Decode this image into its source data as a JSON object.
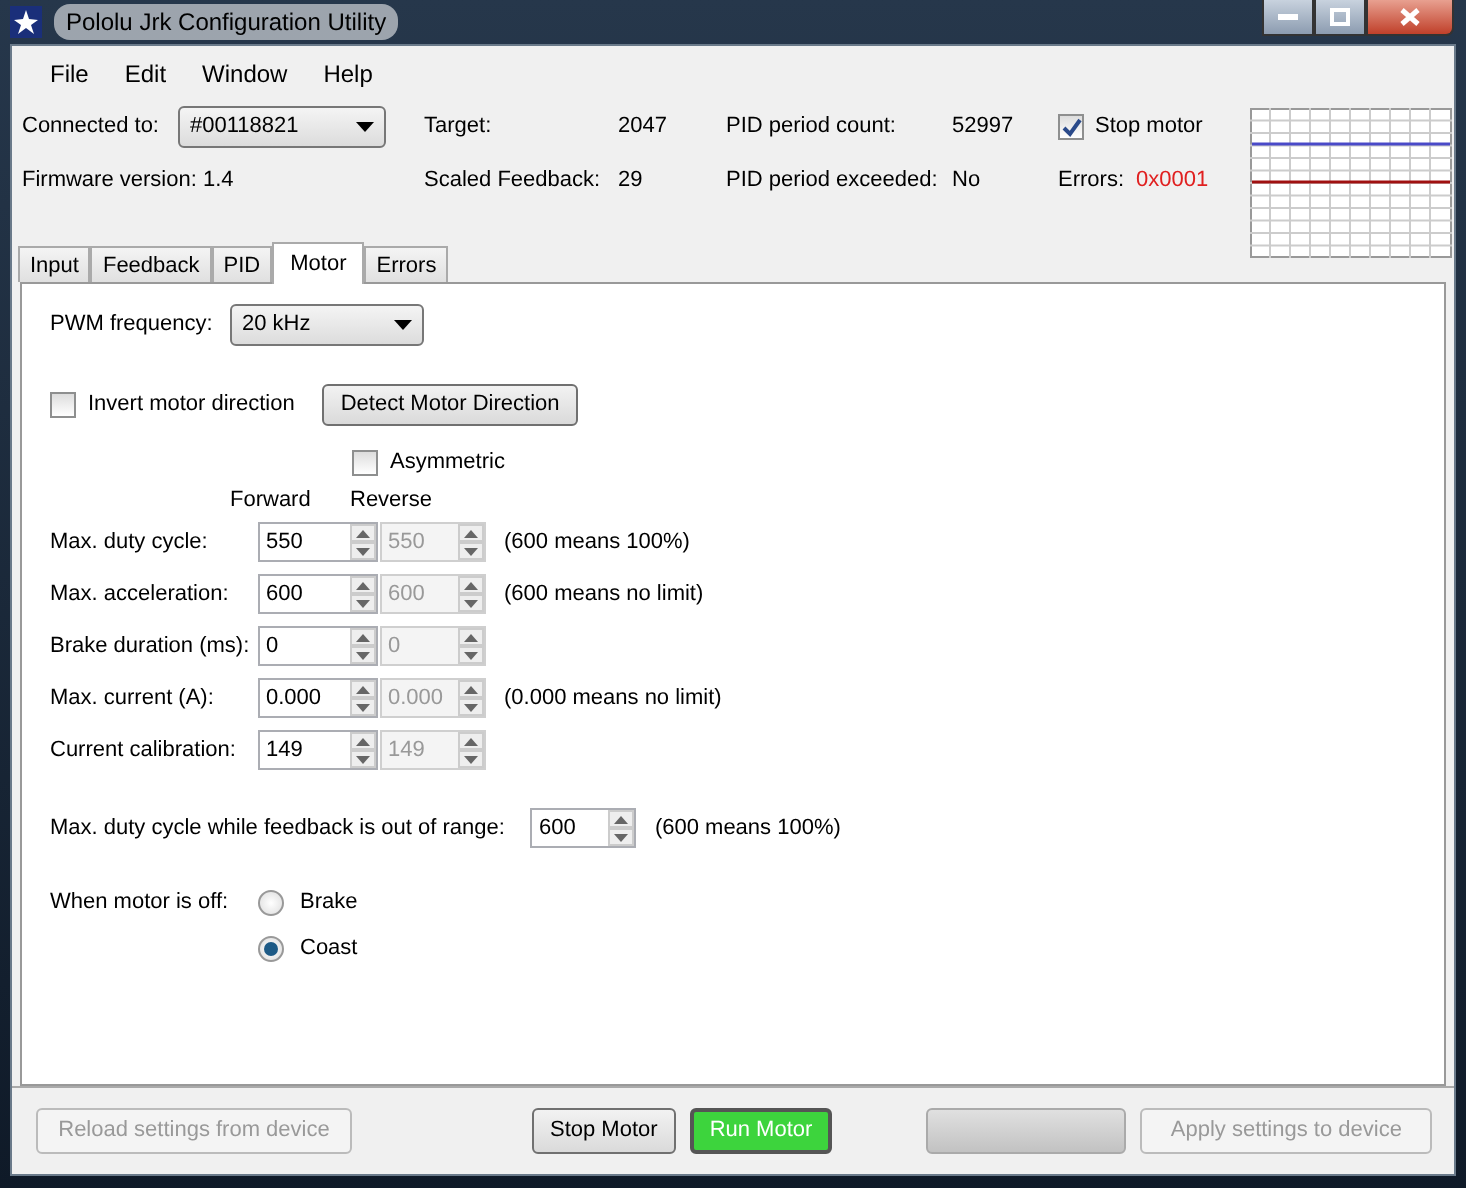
{
  "window": {
    "title": "Pololu Jrk Configuration Utility"
  },
  "menu": [
    "File",
    "Edit",
    "Window",
    "Help"
  ],
  "status": {
    "connected_label": "Connected to:",
    "device": "#00118821",
    "firmware": "Firmware version: 1.4",
    "target_label": "Target:",
    "target": "2047",
    "feedback_label": "Scaled Feedback:",
    "feedback": "29",
    "pid_count_label": "PID period count:",
    "pid_count": "52997",
    "pid_exceeded_label": "PID period exceeded:",
    "pid_exceeded": "No",
    "stop_motor": {
      "label": "Stop motor",
      "checked": true
    },
    "errors_label": "Errors:",
    "errors": "0x0001"
  },
  "tabs": [
    {
      "label": "Input",
      "selected": false
    },
    {
      "label": "Feedback",
      "selected": false
    },
    {
      "label": "PID",
      "selected": false
    },
    {
      "label": "Motor",
      "selected": true
    },
    {
      "label": "Errors",
      "selected": false
    }
  ],
  "motor": {
    "pwm_label": "PWM frequency:",
    "pwm_value": "20 kHz",
    "invert": {
      "label": "Invert motor direction",
      "checked": false
    },
    "detect_button": "Detect Motor Direction",
    "asymmetric": {
      "label": "Asymmetric",
      "checked": false
    },
    "forward_heading": "Forward",
    "reverse_heading": "Reverse",
    "rows": [
      {
        "label": "Max. duty cycle:",
        "forward": "550",
        "reverse": "550",
        "note": "(600 means 100%)"
      },
      {
        "label": "Max. acceleration:",
        "forward": "600",
        "reverse": "600",
        "note": "(600 means no limit)"
      },
      {
        "label": "Brake duration (ms):",
        "forward": "0",
        "reverse": "0"
      },
      {
        "label": "Max. current (A):",
        "forward": "0.000",
        "reverse": "0.000",
        "note": "(0.000 means no limit)"
      },
      {
        "label": "Current calibration:",
        "forward": "149",
        "reverse": "149"
      }
    ],
    "out_of_range": {
      "label": "Max. duty cycle while feedback is out of range:",
      "value": "600",
      "note": "(600 means 100%)"
    },
    "off_label": "When motor is off:",
    "off_options": [
      {
        "label": "Brake",
        "selected": false
      },
      {
        "label": "Coast",
        "selected": true
      }
    ]
  },
  "buttons": [
    {
      "kind": "disabled",
      "label": "Reload settings from device"
    },
    {
      "kind": "normal",
      "label": "Stop Motor"
    },
    {
      "kind": "run",
      "label": "Run Motor"
    },
    {
      "kind": "blank"
    },
    {
      "kind": "disabled",
      "label": "Apply settings to device"
    }
  ]
}
